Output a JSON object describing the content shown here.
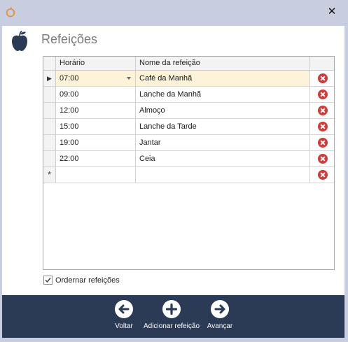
{
  "window": {
    "close_glyph": "✕"
  },
  "header": {
    "title": "Refeições",
    "icon": "apple-icon"
  },
  "grid": {
    "columns": [
      "Horário",
      "Nome da refeição"
    ],
    "rows": [
      {
        "time": "07:00",
        "name": "Café da Manhã",
        "current": true
      },
      {
        "time": "09:00",
        "name": "Lanche da Manhã"
      },
      {
        "time": "12:00",
        "name": "Almoço"
      },
      {
        "time": "15:00",
        "name": "Lanche da Tarde"
      },
      {
        "time": "19:00",
        "name": "Jantar"
      },
      {
        "time": "22:00",
        "name": "Ceia"
      }
    ],
    "current_row_marker": "▶",
    "new_row_marker": "*"
  },
  "options": {
    "order_label": "Ordernar refeições",
    "order_checked": true
  },
  "footer": {
    "back_label": "Voltar",
    "add_label": "Adicionar refeição",
    "next_label": "Avançar"
  },
  "colors": {
    "accent": "#2b3a55",
    "delete": "#d23a3a",
    "current_row": "#fdf3d8",
    "title_bar": "#c8cde0"
  }
}
